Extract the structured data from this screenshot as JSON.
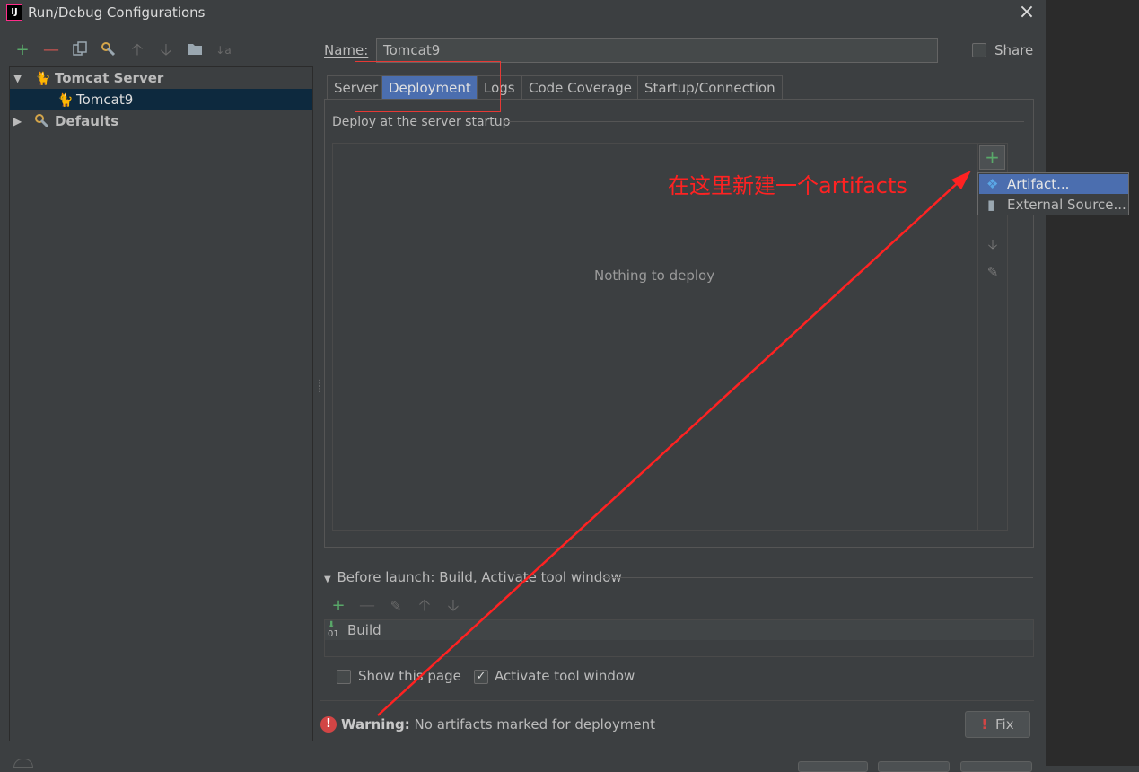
{
  "window": {
    "app_icon": "IJ",
    "title": "Run/Debug Configurations",
    "close_glyph": "×"
  },
  "toolbar": {
    "icons": [
      "add-icon",
      "remove-icon",
      "copy-icon",
      "wrench-icon",
      "move-up-icon",
      "move-down-icon",
      "folder-icon",
      "sort-alpha-icon"
    ]
  },
  "tree": {
    "items": [
      {
        "label": "Tomcat Server",
        "expanded": true,
        "bold": true,
        "icon": "tomcat-icon"
      },
      {
        "label": "Tomcat9",
        "selected": true,
        "icon": "tomcat-config-icon"
      },
      {
        "label": "Defaults",
        "expanded": false,
        "bold": true,
        "icon": "wrench-defaults-icon"
      }
    ]
  },
  "config": {
    "name_label": "Name:",
    "name_value": "Tomcat9",
    "share_label": "Share",
    "share_checked": false
  },
  "tabs": [
    {
      "label": "Server",
      "active": false
    },
    {
      "label": "Deployment",
      "active": true
    },
    {
      "label": "Logs",
      "active": false
    },
    {
      "label": "Code Coverage",
      "active": false
    },
    {
      "label": "Startup/Connection",
      "active": false
    }
  ],
  "deployment": {
    "header": "Deploy at the server startup",
    "empty_text": "Nothing to deploy",
    "add_glyph": "+"
  },
  "popup": {
    "items": [
      {
        "label": "Artifact...",
        "icon": "artifact-icon",
        "selected": true
      },
      {
        "label": "External Source...",
        "icon": "external-source-icon",
        "selected": false
      }
    ]
  },
  "annotation": {
    "text": "在这里新建一个artifacts",
    "color": "#ff2222"
  },
  "before_launch": {
    "label": "Before launch: Build, Activate tool window",
    "tasks": [
      "Build"
    ]
  },
  "options": {
    "show_page": {
      "label": "Show this page",
      "checked": false
    },
    "activate_tool_window": {
      "label": "Activate tool window",
      "checked": true
    }
  },
  "warning": {
    "prefix": "Warning:",
    "message": " No artifacts marked for deployment",
    "fix_label": "Fix"
  },
  "colors": {
    "accent": "#4b6eaf",
    "add": "#59a869",
    "remove": "#c75450",
    "annotation": "#ff2222"
  }
}
